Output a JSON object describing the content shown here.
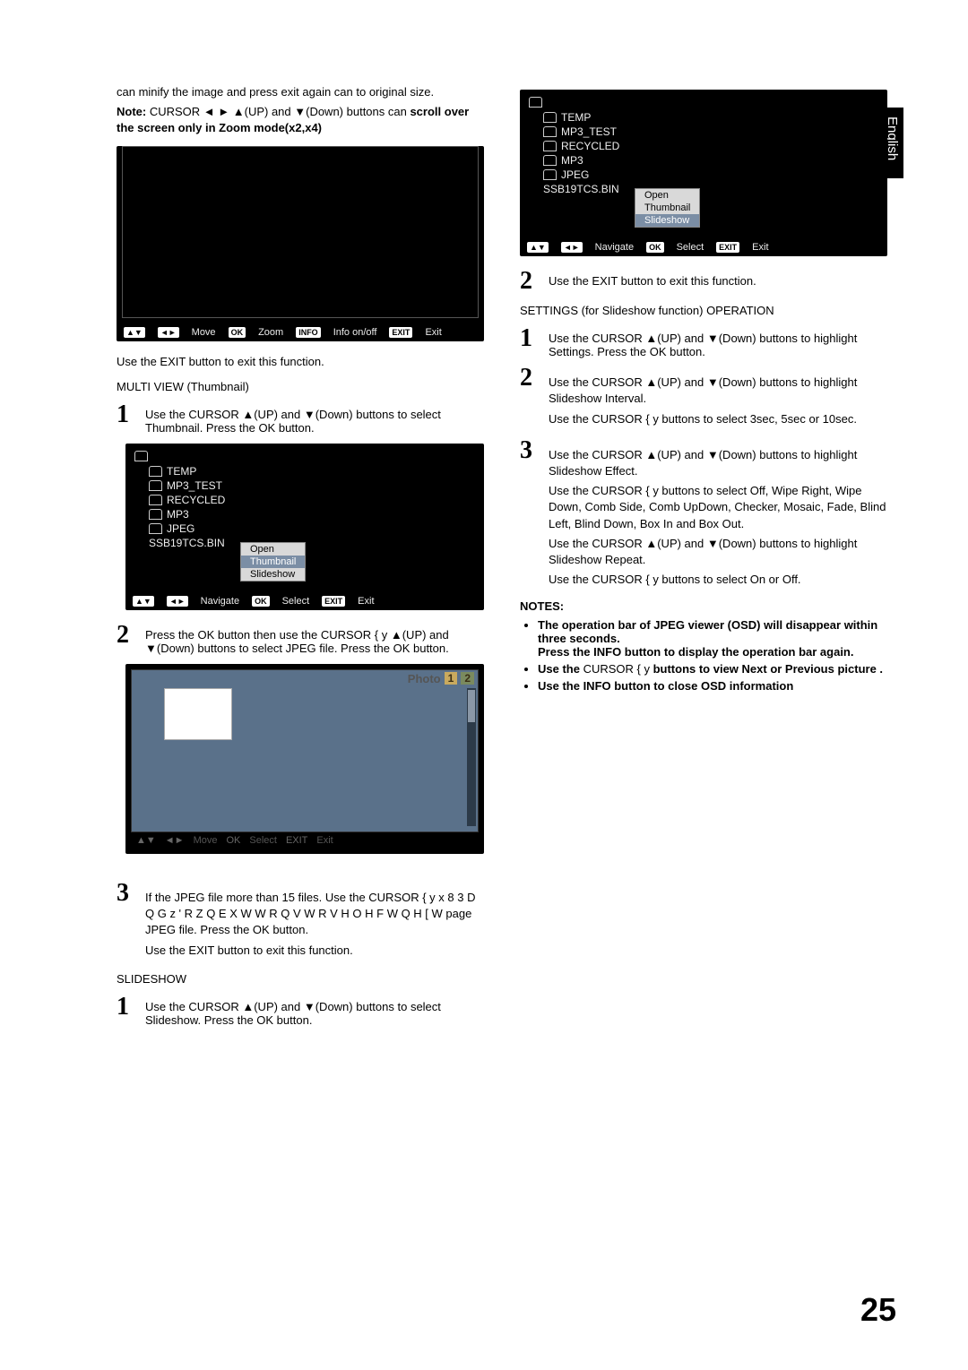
{
  "lang_tab": "English",
  "page_number": "25",
  "left": {
    "intro1": "can minify the image and press exit again can to original size.",
    "note_label": "Note:",
    "note_body": "CURSOR ◄ ► ▲(UP) and ▼(Down) buttons can ",
    "note_bold": "scroll over the screen only in Zoom mode(x2,x4)",
    "osd1_bar": {
      "move": "Move",
      "zoom": "Zoom",
      "info": "Info on/off",
      "exit": "Exit"
    },
    "exit1": "Use the EXIT button to exit this function.",
    "multi_title": "MULTI VIEW (Thumbnail)",
    "step1": "Use the CURSOR ▲(UP) and ▼(Down) buttons to select Thumbnail.  Press the OK button.",
    "tree": {
      "items": [
        "TEMP",
        "MP3_TEST",
        "RECYCLED",
        "MP3",
        "JPEG"
      ],
      "file": "SSB19TCS.BIN",
      "menu_open": "Open",
      "menu_thumbnail": "Thumbnail",
      "menu_slideshow": "Slideshow"
    },
    "osd2_bar": {
      "navigate": "Navigate",
      "select": "Select",
      "exit": "Exit"
    },
    "step2": "Press the OK button then use the CURSOR { y ▲(UP) and ▼(Down) buttons to select JPEG file. Press the OK button.",
    "thumb": {
      "indicator": "1/2"
    },
    "step3a": "If the JPEG file more than 15 files. Use the CURSOR { y x  8 3    D Q G   z  ' R Z Q    E X W W R Q V   W R   V H O H F W   Q H [ W  page JPEG file. Press the OK button.",
    "exit3": "Use the EXIT button to exit this function.",
    "slideshow_title": "SLIDESHOW",
    "step_slide1": "Use the CURSOR ▲(UP) and ▼(Down) buttons to select Slideshow.  Press the OK button."
  },
  "right": {
    "tree": {
      "items": [
        "TEMP",
        "MP3_TEST",
        "RECYCLED",
        "MP3",
        "JPEG"
      ],
      "file": "SSB19TCS.BIN",
      "menu_open": "Open",
      "menu_thumbnail": "Thumbnail",
      "menu_slideshow": "Slideshow"
    },
    "osd_bar": {
      "navigate": "Navigate",
      "select": "Select",
      "exit": "Exit"
    },
    "step2": "Use the EXIT button to exit this function.",
    "settings_title": "SETTINGS (for Slideshow function) OPERATION",
    "s1": "Use the CURSOR ▲(UP) and ▼(Down) buttons to highlight Settings.  Press the OK button.",
    "s2a": "Use the CURSOR ▲(UP) and ▼(Down) buttons to highlight Slideshow Interval.",
    "s2b": "Use the CURSOR  {    y  buttons to select 3sec, 5sec or 10sec.",
    "s3a": "Use the CURSOR ▲(UP) and ▼(Down) buttons to highlight Slideshow Effect.",
    "s3b": "Use the CURSOR  {    y  buttons to select Off, Wipe Right, Wipe Down, Comb Side, Comb UpDown, Checker, Mosaic, Fade, Blind Left, Blind Down, Box In and Box Out.",
    "s3c": "Use the CURSOR ▲(UP) and ▼(Down) buttons to highlight Slideshow Repeat.",
    "s3d": "Use the CURSOR  {    y  buttons to select On or Off.",
    "notes_label": "NOTES:",
    "note1a": "The operation bar of JPEG viewer (OSD) will disappear within three seconds.",
    "note1b": "Press the INFO button to display the operation bar again.",
    "note2a": "Use the ",
    "note2b": "CURSOR  {   y ",
    "note2c": "buttons to view Next or Previous picture .",
    "note3": "Use the INFO button to close OSD information"
  },
  "keys": {
    "updown": "▲▼",
    "leftright": "◄►",
    "ok": "OK",
    "info": "INFO",
    "exit": "EXIT"
  }
}
